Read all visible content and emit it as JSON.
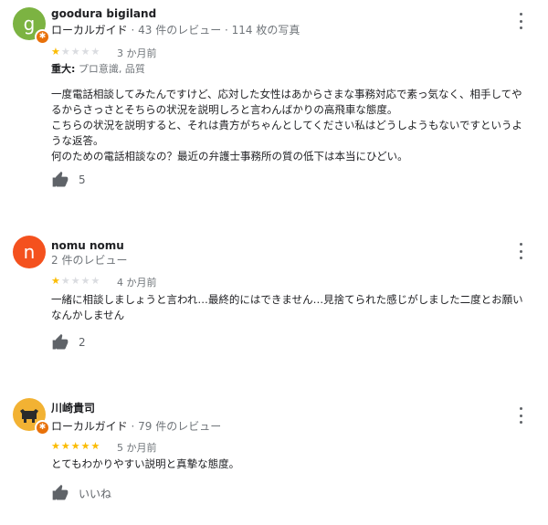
{
  "reviews": [
    {
      "avatar_letter": "g",
      "avatar_color": "#7cb342",
      "has_guide_badge": true,
      "name": "goodura bigiland",
      "guide_label": "ローカルガイド",
      "meta": "· 43 件のレビュー · 114 枚の写真",
      "rating": 1,
      "time": "3 か月前",
      "tags_label": "重大:",
      "tags": "プロ意識, 品質",
      "text": [
        "一度電話相談してみたんですけど、応対した女性はあからさまな事務対応で素っ気なく、相手してや",
        "るからさっさとそちらの状況を説明しろと言わんばかりの高飛車な態度。",
        "こちらの状況を説明すると、それは貴方がちゃんとしてください私はどうしようもないですというよ",
        "うな返答。",
        "何のための電話相談なの？最近の弁護士事務所の質の低下は本当にひどい。"
      ],
      "likes": "5"
    },
    {
      "avatar_letter": "n",
      "avatar_color": "#f4511e",
      "has_guide_badge": false,
      "name": "nomu nomu",
      "meta": "2 件のレビュー",
      "rating": 1,
      "time": "4 か月前",
      "text": [
        "一緒に相談しましょうと言われ…最終的にはできません…見捨てられた感じがしました二度とお願い",
        "なんかしません"
      ],
      "likes": "2"
    },
    {
      "avatar_letter": "",
      "avatar_color": "#f2b233",
      "has_guide_badge": true,
      "name": "川崎貴司",
      "guide_label": "ローカルガイド",
      "meta": "· 79 件のレビュー",
      "rating": 5,
      "time": "5 か月前",
      "text": [
        "とてもわかりやすい説明と真摯な態度。"
      ],
      "likes": "いいね"
    }
  ]
}
